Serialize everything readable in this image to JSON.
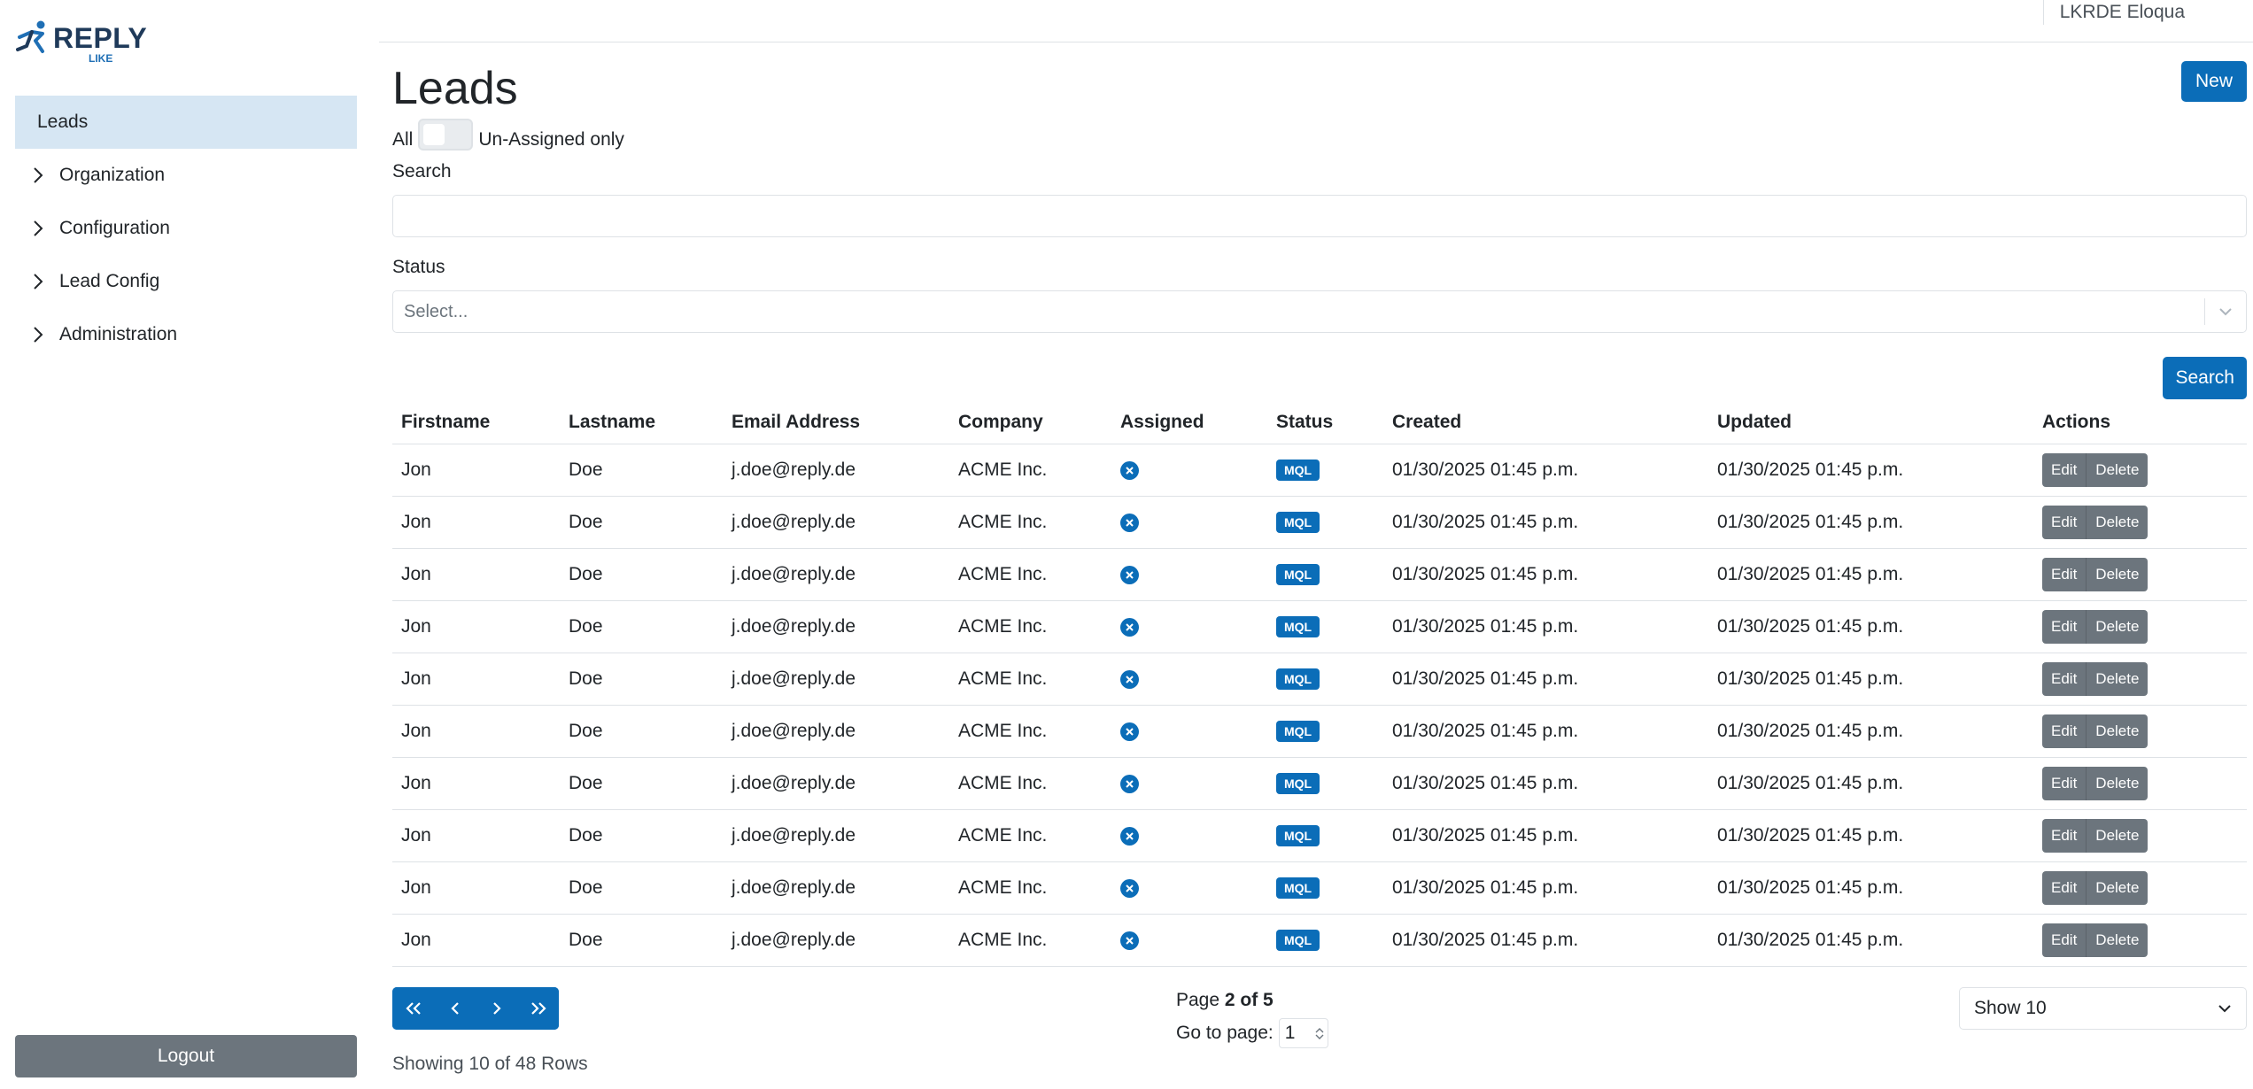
{
  "brand": {
    "name": "REPLY",
    "sub": "LIKE"
  },
  "sidebar": {
    "items": [
      {
        "label": "Leads",
        "active": true
      },
      {
        "label": "Organization"
      },
      {
        "label": "Configuration"
      },
      {
        "label": "Lead Config"
      },
      {
        "label": "Administration"
      }
    ],
    "logout_label": "Logout"
  },
  "topbar": {
    "user": "LKRDE Eloqua"
  },
  "page": {
    "title": "Leads",
    "new_label": "New",
    "toggle_left": "All",
    "toggle_right": "Un-Assigned only",
    "search_label": "Search",
    "search_value": "",
    "status_label": "Status",
    "status_placeholder": "Select...",
    "search_button": "Search"
  },
  "table": {
    "headers": [
      "Firstname",
      "Lastname",
      "Email Address",
      "Company",
      "Assigned",
      "Status",
      "Created",
      "Updated",
      "Actions"
    ],
    "edit_label": "Edit",
    "delete_label": "Delete",
    "rows": [
      {
        "first": "Jon",
        "last": "Doe",
        "email": "j.doe@reply.de",
        "company": "ACME Inc.",
        "status": "MQL",
        "created": "01/30/2025 01:45 p.m.",
        "updated": "01/30/2025 01:45 p.m."
      },
      {
        "first": "Jon",
        "last": "Doe",
        "email": "j.doe@reply.de",
        "company": "ACME Inc.",
        "status": "MQL",
        "created": "01/30/2025 01:45 p.m.",
        "updated": "01/30/2025 01:45 p.m."
      },
      {
        "first": "Jon",
        "last": "Doe",
        "email": "j.doe@reply.de",
        "company": "ACME Inc.",
        "status": "MQL",
        "created": "01/30/2025 01:45 p.m.",
        "updated": "01/30/2025 01:45 p.m."
      },
      {
        "first": "Jon",
        "last": "Doe",
        "email": "j.doe@reply.de",
        "company": "ACME Inc.",
        "status": "MQL",
        "created": "01/30/2025 01:45 p.m.",
        "updated": "01/30/2025 01:45 p.m."
      },
      {
        "first": "Jon",
        "last": "Doe",
        "email": "j.doe@reply.de",
        "company": "ACME Inc.",
        "status": "MQL",
        "created": "01/30/2025 01:45 p.m.",
        "updated": "01/30/2025 01:45 p.m."
      },
      {
        "first": "Jon",
        "last": "Doe",
        "email": "j.doe@reply.de",
        "company": "ACME Inc.",
        "status": "MQL",
        "created": "01/30/2025 01:45 p.m.",
        "updated": "01/30/2025 01:45 p.m."
      },
      {
        "first": "Jon",
        "last": "Doe",
        "email": "j.doe@reply.de",
        "company": "ACME Inc.",
        "status": "MQL",
        "created": "01/30/2025 01:45 p.m.",
        "updated": "01/30/2025 01:45 p.m."
      },
      {
        "first": "Jon",
        "last": "Doe",
        "email": "j.doe@reply.de",
        "company": "ACME Inc.",
        "status": "MQL",
        "created": "01/30/2025 01:45 p.m.",
        "updated": "01/30/2025 01:45 p.m."
      },
      {
        "first": "Jon",
        "last": "Doe",
        "email": "j.doe@reply.de",
        "company": "ACME Inc.",
        "status": "MQL",
        "created": "01/30/2025 01:45 p.m.",
        "updated": "01/30/2025 01:45 p.m."
      },
      {
        "first": "Jon",
        "last": "Doe",
        "email": "j.doe@reply.de",
        "company": "ACME Inc.",
        "status": "MQL",
        "created": "01/30/2025 01:45 p.m.",
        "updated": "01/30/2025 01:45 p.m."
      }
    ]
  },
  "pagination": {
    "page_prefix": "Page",
    "page_of": "2 of 5",
    "goto_label": "Go to page:",
    "goto_value": "1",
    "show_label": "Show 10",
    "showing_text": "Showing 10 of 48 Rows"
  },
  "colors": {
    "primary": "#0b6db8",
    "secondary": "#6c757d",
    "active_nav": "#d6e6f3"
  },
  "icons": {
    "nav": "chevron-right-icon",
    "assigned": "x-circle-icon",
    "pager": [
      "double-chevron-left-icon",
      "chevron-left-icon",
      "chevron-right-icon",
      "double-chevron-right-icon"
    ]
  }
}
